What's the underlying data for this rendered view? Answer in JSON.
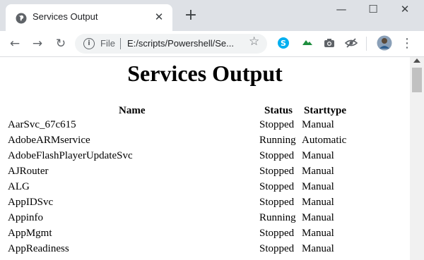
{
  "browser": {
    "tab_title": "Services Output",
    "tab_close": "✕",
    "new_tab": "+",
    "window_controls": {
      "minimize": "—",
      "maximize": "☐",
      "close": "✕"
    },
    "nav": {
      "back": "←",
      "forward": "→",
      "reload": "↻"
    },
    "omnibox": {
      "info": "i",
      "scheme": "File",
      "url": "E:/scripts/Powershell/Se..."
    },
    "bookmark_star": "☆",
    "menu": "⋮",
    "extensions": [
      "skype-icon",
      "extension-icon",
      "camera-icon",
      "eye-off-icon"
    ],
    "colors": {
      "tabstrip": "#dee1e6",
      "omnibox": "#f1f3f4",
      "skype": "#00aff0"
    }
  },
  "page": {
    "title": "Services Output",
    "columns": {
      "name": "Name",
      "status": "Status",
      "starttype": "Starttype"
    },
    "rows": [
      {
        "name": "AarSvc_67c615",
        "status": "Stopped",
        "starttype": "Manual"
      },
      {
        "name": "AdobeARMservice",
        "status": "Running",
        "starttype": "Automatic"
      },
      {
        "name": "AdobeFlashPlayerUpdateSvc",
        "status": "Stopped",
        "starttype": "Manual"
      },
      {
        "name": "AJRouter",
        "status": "Stopped",
        "starttype": "Manual"
      },
      {
        "name": "ALG",
        "status": "Stopped",
        "starttype": "Manual"
      },
      {
        "name": "AppIDSvc",
        "status": "Stopped",
        "starttype": "Manual"
      },
      {
        "name": "Appinfo",
        "status": "Running",
        "starttype": "Manual"
      },
      {
        "name": "AppMgmt",
        "status": "Stopped",
        "starttype": "Manual"
      },
      {
        "name": "AppReadiness",
        "status": "Stopped",
        "starttype": "Manual"
      }
    ]
  }
}
